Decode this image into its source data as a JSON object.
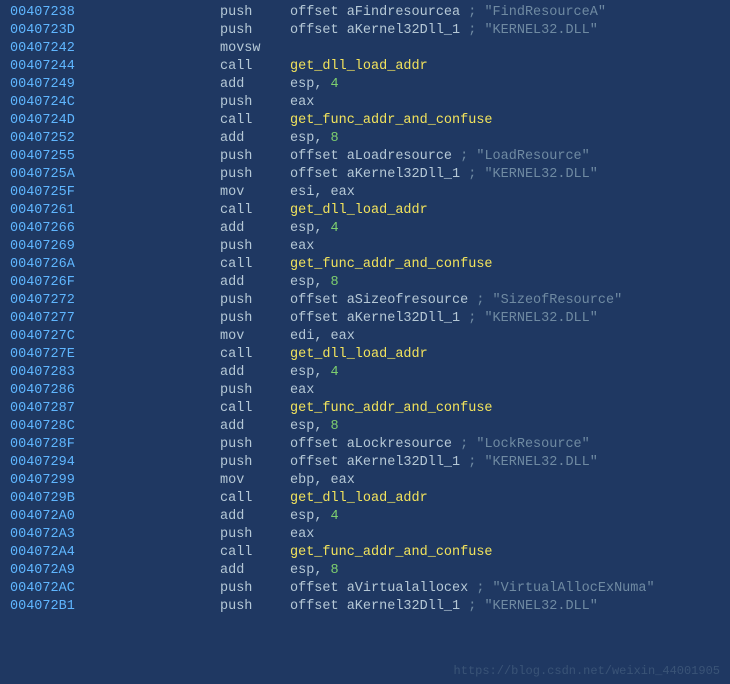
{
  "watermark": "https://blog.csdn.net/weixin_44001905",
  "rows": [
    {
      "addr": "00407238",
      "mnem": "push",
      "operand_parts": [
        {
          "t": "op",
          "v": "offset aFindresourcea "
        },
        {
          "t": "gray",
          "v": "; "
        },
        {
          "t": "str",
          "v": "\"FindResourceA\""
        }
      ]
    },
    {
      "addr": "0040723D",
      "mnem": "push",
      "operand_parts": [
        {
          "t": "op",
          "v": "offset aKernel32Dll_1 "
        },
        {
          "t": "gray",
          "v": "; "
        },
        {
          "t": "str",
          "v": "\"KERNEL32.DLL\""
        }
      ]
    },
    {
      "addr": "00407242",
      "mnem": "movsw",
      "operand_parts": []
    },
    {
      "addr": "00407244",
      "mnem": "call",
      "operand_parts": [
        {
          "t": "func",
          "v": "get_dll_load_addr"
        }
      ]
    },
    {
      "addr": "00407249",
      "mnem": "add",
      "operand_parts": [
        {
          "t": "reg",
          "v": "esp"
        },
        {
          "t": "op",
          "v": ", "
        },
        {
          "t": "num",
          "v": "4"
        }
      ]
    },
    {
      "addr": "0040724C",
      "mnem": "push",
      "operand_parts": [
        {
          "t": "reg",
          "v": "eax"
        }
      ]
    },
    {
      "addr": "0040724D",
      "mnem": "call",
      "operand_parts": [
        {
          "t": "func",
          "v": "get_func_addr_and_confuse"
        }
      ]
    },
    {
      "addr": "00407252",
      "mnem": "add",
      "operand_parts": [
        {
          "t": "reg",
          "v": "esp"
        },
        {
          "t": "op",
          "v": ", "
        },
        {
          "t": "num",
          "v": "8"
        }
      ]
    },
    {
      "addr": "00407255",
      "mnem": "push",
      "operand_parts": [
        {
          "t": "op",
          "v": "offset aLoadresource "
        },
        {
          "t": "gray",
          "v": "; "
        },
        {
          "t": "str",
          "v": "\"LoadResource\""
        }
      ]
    },
    {
      "addr": "0040725A",
      "mnem": "push",
      "operand_parts": [
        {
          "t": "op",
          "v": "offset aKernel32Dll_1 "
        },
        {
          "t": "gray",
          "v": "; "
        },
        {
          "t": "str",
          "v": "\"KERNEL32.DLL\""
        }
      ]
    },
    {
      "addr": "0040725F",
      "mnem": "mov",
      "operand_parts": [
        {
          "t": "reg",
          "v": "esi"
        },
        {
          "t": "op",
          "v": ", "
        },
        {
          "t": "reg",
          "v": "eax"
        }
      ]
    },
    {
      "addr": "00407261",
      "mnem": "call",
      "operand_parts": [
        {
          "t": "func",
          "v": "get_dll_load_addr"
        }
      ]
    },
    {
      "addr": "00407266",
      "mnem": "add",
      "operand_parts": [
        {
          "t": "reg",
          "v": "esp"
        },
        {
          "t": "op",
          "v": ", "
        },
        {
          "t": "num",
          "v": "4"
        }
      ]
    },
    {
      "addr": "00407269",
      "mnem": "push",
      "operand_parts": [
        {
          "t": "reg",
          "v": "eax"
        }
      ]
    },
    {
      "addr": "0040726A",
      "mnem": "call",
      "operand_parts": [
        {
          "t": "func",
          "v": "get_func_addr_and_confuse"
        }
      ]
    },
    {
      "addr": "0040726F",
      "mnem": "add",
      "operand_parts": [
        {
          "t": "reg",
          "v": "esp"
        },
        {
          "t": "op",
          "v": ", "
        },
        {
          "t": "num",
          "v": "8"
        }
      ]
    },
    {
      "addr": "00407272",
      "mnem": "push",
      "operand_parts": [
        {
          "t": "op",
          "v": "offset aSizeofresource "
        },
        {
          "t": "gray",
          "v": "; "
        },
        {
          "t": "str",
          "v": "\"SizeofResource\""
        }
      ]
    },
    {
      "addr": "00407277",
      "mnem": "push",
      "operand_parts": [
        {
          "t": "op",
          "v": "offset aKernel32Dll_1 "
        },
        {
          "t": "gray",
          "v": "; "
        },
        {
          "t": "str",
          "v": "\"KERNEL32.DLL\""
        }
      ]
    },
    {
      "addr": "0040727C",
      "mnem": "mov",
      "operand_parts": [
        {
          "t": "reg",
          "v": "edi"
        },
        {
          "t": "op",
          "v": ", "
        },
        {
          "t": "reg",
          "v": "eax"
        }
      ]
    },
    {
      "addr": "0040727E",
      "mnem": "call",
      "operand_parts": [
        {
          "t": "func",
          "v": "get_dll_load_addr"
        }
      ]
    },
    {
      "addr": "00407283",
      "mnem": "add",
      "operand_parts": [
        {
          "t": "reg",
          "v": "esp"
        },
        {
          "t": "op",
          "v": ", "
        },
        {
          "t": "num",
          "v": "4"
        }
      ]
    },
    {
      "addr": "00407286",
      "mnem": "push",
      "operand_parts": [
        {
          "t": "reg",
          "v": "eax"
        }
      ]
    },
    {
      "addr": "00407287",
      "mnem": "call",
      "operand_parts": [
        {
          "t": "func",
          "v": "get_func_addr_and_confuse"
        }
      ]
    },
    {
      "addr": "0040728C",
      "mnem": "add",
      "operand_parts": [
        {
          "t": "reg",
          "v": "esp"
        },
        {
          "t": "op",
          "v": ", "
        },
        {
          "t": "num",
          "v": "8"
        }
      ]
    },
    {
      "addr": "0040728F",
      "mnem": "push",
      "operand_parts": [
        {
          "t": "op",
          "v": "offset aLockresource "
        },
        {
          "t": "gray",
          "v": "; "
        },
        {
          "t": "str",
          "v": "\"LockResource\""
        }
      ]
    },
    {
      "addr": "00407294",
      "mnem": "push",
      "operand_parts": [
        {
          "t": "op",
          "v": "offset aKernel32Dll_1 "
        },
        {
          "t": "gray",
          "v": "; "
        },
        {
          "t": "str",
          "v": "\"KERNEL32.DLL\""
        }
      ]
    },
    {
      "addr": "00407299",
      "mnem": "mov",
      "operand_parts": [
        {
          "t": "reg",
          "v": "ebp"
        },
        {
          "t": "op",
          "v": ", "
        },
        {
          "t": "reg",
          "v": "eax"
        }
      ]
    },
    {
      "addr": "0040729B",
      "mnem": "call",
      "operand_parts": [
        {
          "t": "func",
          "v": "get_dll_load_addr"
        }
      ]
    },
    {
      "addr": "004072A0",
      "mnem": "add",
      "operand_parts": [
        {
          "t": "reg",
          "v": "esp"
        },
        {
          "t": "op",
          "v": ", "
        },
        {
          "t": "num",
          "v": "4"
        }
      ]
    },
    {
      "addr": "004072A3",
      "mnem": "push",
      "operand_parts": [
        {
          "t": "reg",
          "v": "eax"
        }
      ]
    },
    {
      "addr": "004072A4",
      "mnem": "call",
      "operand_parts": [
        {
          "t": "func",
          "v": "get_func_addr_and_confuse"
        }
      ]
    },
    {
      "addr": "004072A9",
      "mnem": "add",
      "operand_parts": [
        {
          "t": "reg",
          "v": "esp"
        },
        {
          "t": "op",
          "v": ", "
        },
        {
          "t": "num",
          "v": "8"
        }
      ]
    },
    {
      "addr": "004072AC",
      "mnem": "push",
      "operand_parts": [
        {
          "t": "op",
          "v": "offset aVirtualallocex "
        },
        {
          "t": "gray",
          "v": "; "
        },
        {
          "t": "str",
          "v": "\"VirtualAllocExNuma\""
        }
      ]
    },
    {
      "addr": "004072B1",
      "mnem": "push",
      "operand_parts": [
        {
          "t": "op",
          "v": "offset aKernel32Dll_1 "
        },
        {
          "t": "gray",
          "v": "; "
        },
        {
          "t": "str",
          "v": "\"KERNEL32.DLL\""
        }
      ]
    }
  ]
}
